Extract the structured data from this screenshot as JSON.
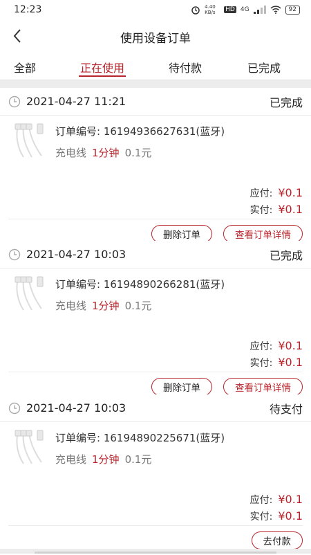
{
  "status_bar": {
    "time": "12:23",
    "speed": "4.40 KB/s",
    "hd": "HD",
    "network": "4G",
    "battery": "92"
  },
  "nav": {
    "title": "使用设备订单"
  },
  "tabs": [
    {
      "label": "全部"
    },
    {
      "label": "正在使用"
    },
    {
      "label": "待付款"
    },
    {
      "label": "已完成"
    }
  ],
  "labels": {
    "order_prefix": "订单编号: ",
    "payable": "应付:",
    "paid": "实付:"
  },
  "orders": [
    {
      "time": "2021-04-27 11:21",
      "status": "已完成",
      "order_no": "订单编号: 16194936627631(蓝牙)",
      "product": "充电线",
      "duration": "1分钟",
      "price": "0.1元",
      "payable": "¥0.1",
      "paid": "¥0.1",
      "btn1": "删除订单",
      "btn2": "查看订单详情"
    },
    {
      "time": "2021-04-27 10:03",
      "status": "已完成",
      "order_no": "订单编号: 16194890266281(蓝牙)",
      "product": "充电线",
      "duration": "1分钟",
      "price": "0.1元",
      "payable": "¥0.1",
      "paid": "¥0.1",
      "btn1": "删除订单",
      "btn2": "查看订单详情"
    },
    {
      "time": "2021-04-27 10:03",
      "status": "待支付",
      "order_no": "订单编号: 16194890225671(蓝牙)",
      "product": "充电线",
      "duration": "1分钟",
      "price": "0.1元",
      "payable": "¥0.1",
      "paid": "¥0.1",
      "btn1": "去付款"
    }
  ],
  "colors": {
    "accent": "#b8242b"
  }
}
